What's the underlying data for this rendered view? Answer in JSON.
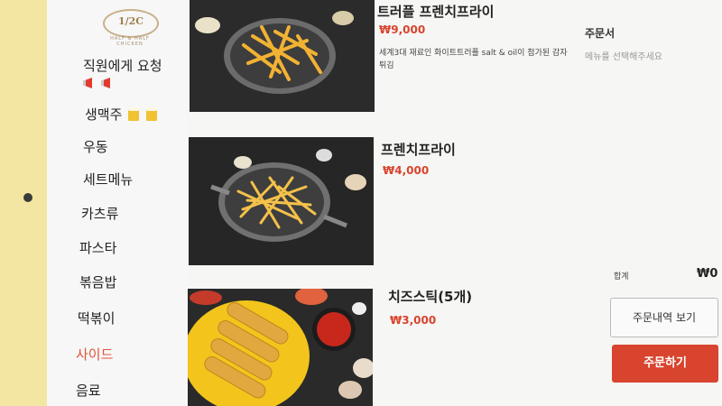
{
  "brand": {
    "logo_text": "1/2C",
    "logo_subtext": "HALF & HALF CHICKEN"
  },
  "sidebar": {
    "items": [
      {
        "label": "직원에게 요청",
        "icon": "megaphone-icon"
      },
      {
        "label": "생맥주",
        "icon": "beer-icon"
      },
      {
        "label": "우동"
      },
      {
        "label": "세트메뉴"
      },
      {
        "label": "카츠류"
      },
      {
        "label": "파스타"
      },
      {
        "label": "볶음밥"
      },
      {
        "label": "떡볶이"
      },
      {
        "label": "사이드",
        "active": true
      },
      {
        "label": "음료"
      }
    ]
  },
  "menu": {
    "items": [
      {
        "name": "트러플 프렌치프라이",
        "price": "₩9,000",
        "desc": "세계3대 재료인 화이트트러플 salt & oil이 첨가된 감자튀김"
      },
      {
        "name": "프렌치프라이",
        "price": "₩4,000"
      },
      {
        "name": "치즈스틱(5개)",
        "price": "₩3,000"
      }
    ]
  },
  "order": {
    "title": "주문서",
    "empty_message": "메뉴를 선택해주세요",
    "total_label": "합계",
    "total_value": "₩0",
    "history_button": "주문내역 보기",
    "order_button": "주문하기"
  },
  "colors": {
    "accent": "#d8442e",
    "active_nav": "#e0533a",
    "bezel": "#efe2a0"
  }
}
